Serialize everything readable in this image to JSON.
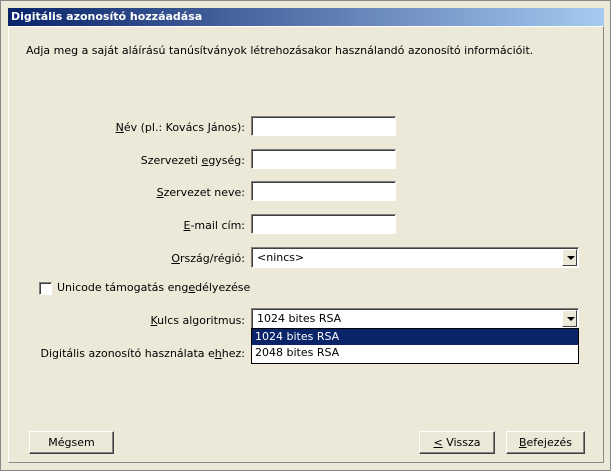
{
  "window": {
    "title": "Digitális azonosító hozzáadása"
  },
  "intro": "Adja meg a saját aláírású tanúsítványok létrehozásakor használandó azonosító információit.",
  "fields": {
    "name": {
      "label_u": "N",
      "label_rest": "év (pl.: Kovács János):",
      "value": ""
    },
    "org_unit": {
      "label_pre": "Szervezeti ",
      "label_u": "e",
      "label_rest": "gység:",
      "value": ""
    },
    "org_name": {
      "label_u": "S",
      "label_rest": "zervezet neve:",
      "value": ""
    },
    "email": {
      "label_u": "E",
      "label_rest": "-mail cím:",
      "value": ""
    },
    "country": {
      "label_u": "O",
      "label_rest": "rszág/régió:",
      "value": "<nincs>"
    }
  },
  "unicode": {
    "label_pre": "Unicode támogatás eng",
    "label_u": "e",
    "label_rest": "délyezése",
    "checked": false
  },
  "key_algorithm": {
    "label_u": "K",
    "label_rest": "ulcs algoritmus:",
    "value": "1024 bites RSA",
    "options": [
      "1024 bites RSA",
      "2048 bites RSA"
    ]
  },
  "usage": {
    "label_pre": "Digitális azonosító használata e",
    "label_u": "h",
    "label_rest": "hez:"
  },
  "buttons": {
    "cancel": "Mégsem",
    "back_u": "<",
    "back_rest": " Vissza",
    "finish_u": "B",
    "finish_rest": "efejezés"
  }
}
